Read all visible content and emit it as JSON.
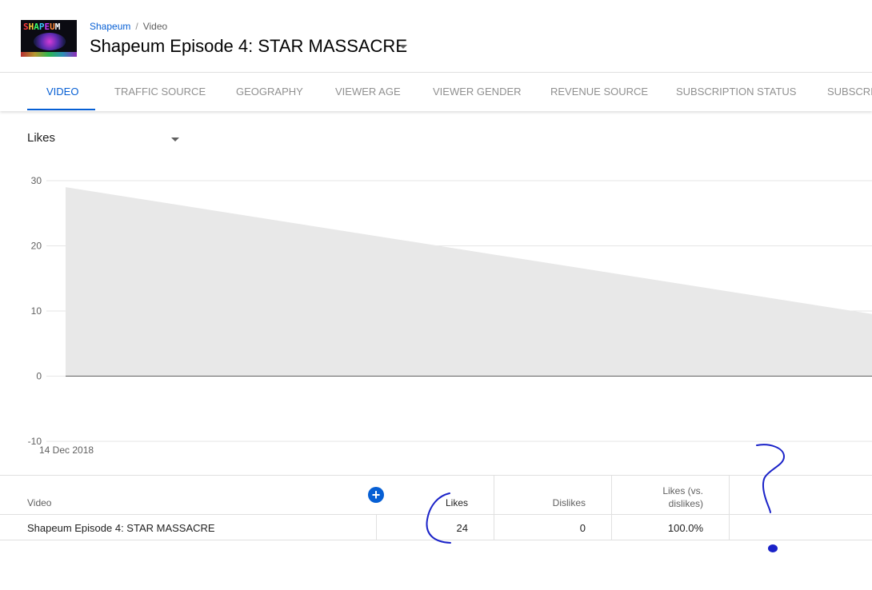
{
  "header": {
    "thumbnail_text": "SHAPEUM",
    "breadcrumb": {
      "channel": "Shapeum",
      "separator": "/",
      "section": "Video"
    },
    "title": "Shapeum Episode 4: STAR MASSACRE"
  },
  "tabs": [
    {
      "label": "Video",
      "active": true
    },
    {
      "label": "Traffic source",
      "active": false
    },
    {
      "label": "Geography",
      "active": false
    },
    {
      "label": "Viewer age",
      "active": false
    },
    {
      "label": "Viewer gender",
      "active": false
    },
    {
      "label": "Revenue source",
      "active": false
    },
    {
      "label": "Subscription status",
      "active": false
    },
    {
      "label": "Subscri",
      "active": false
    }
  ],
  "metric_selector": {
    "selected": "Likes"
  },
  "chart_data": {
    "type": "area",
    "ylim": [
      -10,
      30
    ],
    "yticks": [
      "30",
      "20",
      "10",
      "0",
      "-10"
    ],
    "x_start_label": "14 Dec 2018",
    "series": [
      {
        "values": [
          29,
          9.5
        ]
      }
    ],
    "fill": "#e8e8e8",
    "grid": true
  },
  "table": {
    "columns": [
      "Video",
      "Likes",
      "Dislikes",
      "Likes (vs. dislikes)"
    ],
    "rows": [
      {
        "video": "Shapeum Episode 4: STAR MASSACRE",
        "likes": "24",
        "dislikes": "0",
        "ratio": "100.0%"
      }
    ]
  },
  "colors": {
    "accent": "#065fd4",
    "annotation": "#1a22c8"
  }
}
